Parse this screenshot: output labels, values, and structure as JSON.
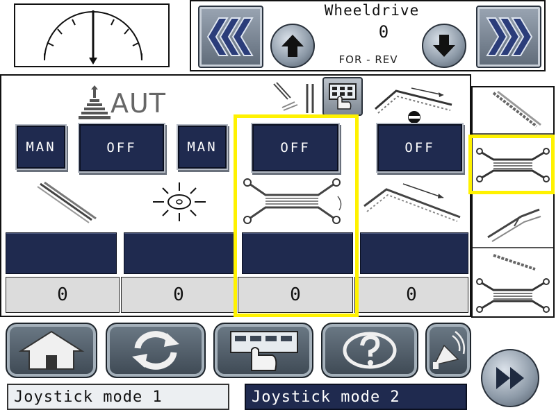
{
  "wheeldrive": {
    "title": "Wheeldrive",
    "value": "0",
    "direction_label": "FOR - REV"
  },
  "mode_buttons": {
    "man_1": "MAN",
    "off_1": "OFF",
    "man_2": "MAN",
    "off_2": "OFF",
    "off_3": "OFF"
  },
  "aut_label": "AUT",
  "values": [
    "0",
    "0",
    "0",
    "0"
  ],
  "joystick": {
    "mode1": "Joystick mode 1",
    "mode2": "Joystick mode 2"
  },
  "colors": {
    "button_navy": "#1f2a4f",
    "highlight": "#fff200",
    "value_bg": "#dcdcdc"
  },
  "icons": {
    "gauge": "gauge-dial-icon",
    "prev": "chevrons-left-icon",
    "next": "chevrons-right-icon",
    "up": "arrow-up-icon",
    "down": "arrow-down-icon",
    "home": "home-icon",
    "refresh": "refresh-icon",
    "keypad": "keypad-hand-icon",
    "help": "help-icon",
    "horn": "horn-icon",
    "forward": "fast-forward-icon"
  }
}
